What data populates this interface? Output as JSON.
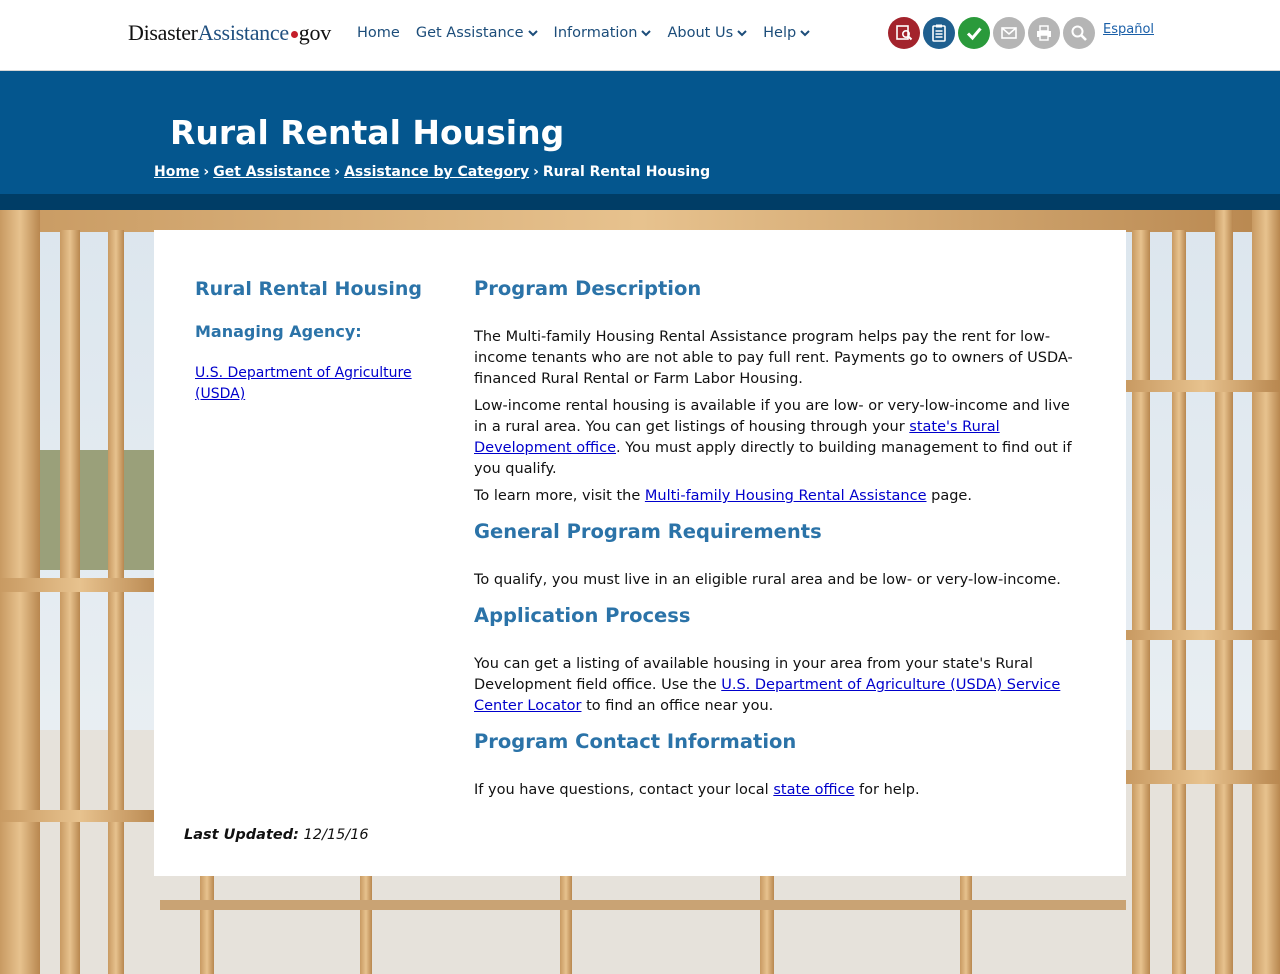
{
  "logo": {
    "part1": "Disaster",
    "part2": "Assistance",
    "part3": "gov"
  },
  "nav": {
    "home": "Home",
    "get_assistance": "Get Assistance",
    "information": "Information",
    "about_us": "About Us",
    "help": "Help"
  },
  "toolbar": {
    "language_link": "Español",
    "icon_colors": [
      "#a3232c",
      "#1f5f8f",
      "#2a9a3b",
      "#b5b5b5",
      "#b5b5b5",
      "#b5b5b5"
    ]
  },
  "header": {
    "title": "Rural Rental Housing",
    "breadcrumb": {
      "home": "Home",
      "get_assistance": "Get Assistance",
      "assistance_by_category": "Assistance by Category",
      "current": "Rural Rental Housing"
    }
  },
  "sidebar": {
    "title": "Rural Rental Housing",
    "managing_agency_label": "Managing Agency:",
    "agency_link": "U.S. Department of Agriculture (USDA)"
  },
  "content": {
    "program_description": {
      "heading": "Program Description",
      "p1": "The Multi-family Housing Rental Assistance program helps pay the rent for low-income tenants who are not able to pay full rent. Payments go to owners of USDA-financed Rural Rental or Farm Labor Housing.",
      "p2_before": "Low-income rental housing is available if you are low- or very-low-income and live in a rural area. You can get listings of housing through your ",
      "p2_link": "state's Rural Development office",
      "p2_after": ". You must apply directly to building management to find out if you qualify.",
      "p3_before": "To learn more, visit the ",
      "p3_link": "Multi-family Housing Rental Assistance",
      "p3_after": " page."
    },
    "requirements": {
      "heading": "General Program Requirements",
      "p1": "To qualify, you must live in an eligible rural area and be low- or very-low-income."
    },
    "application": {
      "heading": "Application Process",
      "p1_before": "You can get a listing of available housing in your area from your state's Rural Development field office. Use the ",
      "p1_link": "U.S. Department of Agriculture (USDA) Service Center Locator",
      "p1_after": " to find an office near you."
    },
    "contact": {
      "heading": "Program Contact Information",
      "p1_before": "If you have questions, contact your local ",
      "p1_link": "state office",
      "p1_after": " for help."
    }
  },
  "footer": {
    "last_updated_label": "Last Updated:",
    "last_updated_date": "12/15/16"
  }
}
